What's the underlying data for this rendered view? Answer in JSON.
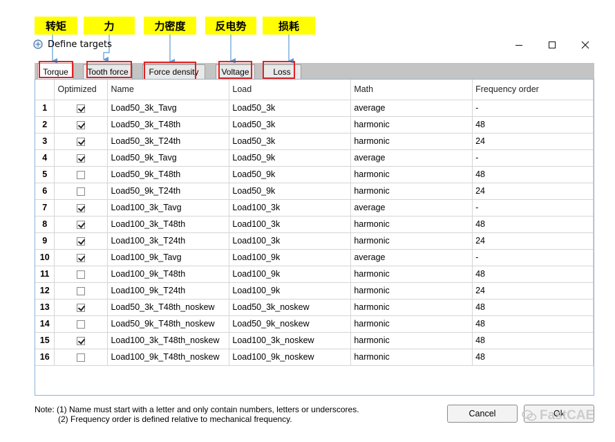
{
  "annotations": [
    "转矩",
    "力",
    "力密度",
    "反电势",
    "损耗"
  ],
  "window": {
    "title": "Define targets"
  },
  "tabs": [
    "Torque",
    "Tooth force",
    "Force density",
    "Voltage",
    "Loss"
  ],
  "columns": [
    "Optimized",
    "Name",
    "Load",
    "Math",
    "Frequency order"
  ],
  "rows": [
    {
      "n": "1",
      "opt": true,
      "name": "Load50_3k_Tavg",
      "load": "Load50_3k",
      "math": "average",
      "freq": "-"
    },
    {
      "n": "2",
      "opt": true,
      "name": "Load50_3k_T48th",
      "load": "Load50_3k",
      "math": "harmonic",
      "freq": "48"
    },
    {
      "n": "3",
      "opt": true,
      "name": "Load50_3k_T24th",
      "load": "Load50_3k",
      "math": "harmonic",
      "freq": "24"
    },
    {
      "n": "4",
      "opt": true,
      "name": "Load50_9k_Tavg",
      "load": "Load50_9k",
      "math": "average",
      "freq": "-"
    },
    {
      "n": "5",
      "opt": false,
      "name": "Load50_9k_T48th",
      "load": "Load50_9k",
      "math": "harmonic",
      "freq": "48"
    },
    {
      "n": "6",
      "opt": false,
      "name": "Load50_9k_T24th",
      "load": "Load50_9k",
      "math": "harmonic",
      "freq": "24"
    },
    {
      "n": "7",
      "opt": true,
      "name": "Load100_3k_Tavg",
      "load": "Load100_3k",
      "math": "average",
      "freq": "-"
    },
    {
      "n": "8",
      "opt": true,
      "name": "Load100_3k_T48th",
      "load": "Load100_3k",
      "math": "harmonic",
      "freq": "48"
    },
    {
      "n": "9",
      "opt": true,
      "name": "Load100_3k_T24th",
      "load": "Load100_3k",
      "math": "harmonic",
      "freq": "24"
    },
    {
      "n": "10",
      "opt": true,
      "name": "Load100_9k_Tavg",
      "load": "Load100_9k",
      "math": "average",
      "freq": "-"
    },
    {
      "n": "11",
      "opt": false,
      "name": "Load100_9k_T48th",
      "load": "Load100_9k",
      "math": "harmonic",
      "freq": "48"
    },
    {
      "n": "12",
      "opt": false,
      "name": "Load100_9k_T24th",
      "load": "Load100_9k",
      "math": "harmonic",
      "freq": "24"
    },
    {
      "n": "13",
      "opt": true,
      "name": "Load50_3k_T48th_noskew",
      "load": "Load50_3k_noskew",
      "math": "harmonic",
      "freq": "48"
    },
    {
      "n": "14",
      "opt": false,
      "name": "Load50_9k_T48th_noskew",
      "load": "Load50_9k_noskew",
      "math": "harmonic",
      "freq": "48"
    },
    {
      "n": "15",
      "opt": true,
      "name": "Load100_3k_T48th_noskew",
      "load": "Load100_3k_noskew",
      "math": "harmonic",
      "freq": "48"
    },
    {
      "n": "16",
      "opt": false,
      "name": "Load100_9k_T48th_noskew",
      "load": "Load100_9k_noskew",
      "math": "harmonic",
      "freq": "48"
    }
  ],
  "note": {
    "line1": "Note: (1) Name must start with a letter and only contain numbers, letters or underscores.",
    "line2": "(2) Frequency order is defined relative to mechanical frequency."
  },
  "buttons": {
    "cancel": "Cancel",
    "ok": "Ok"
  },
  "watermark": "FastCAE",
  "colors": {
    "annotation_bg": "#ffff00",
    "highlight_border": "#e32020",
    "arrow": "#5b9bd5"
  }
}
